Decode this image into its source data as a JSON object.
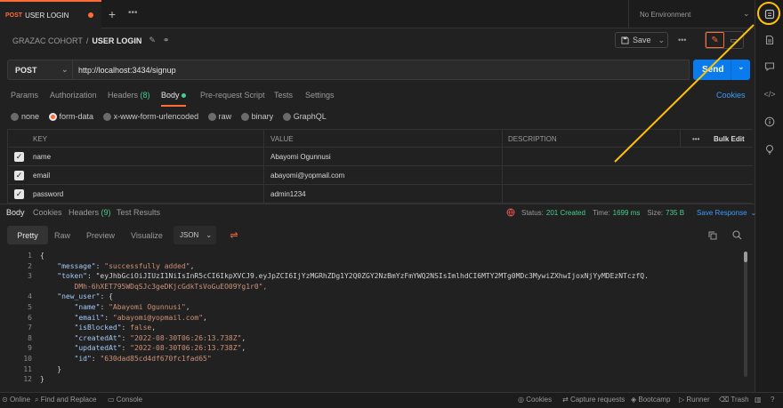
{
  "tab": {
    "method": "POST",
    "name": "USER LOGIN"
  },
  "environment": "No Environment",
  "breadcrumb": {
    "collection": "GRAZAC COHORT",
    "separator": "/",
    "request": "USER LOGIN"
  },
  "save_label": "Save",
  "request": {
    "method": "POST",
    "url": "http://localhost:3434/signup",
    "send_label": "Send"
  },
  "req_tabs": {
    "params": "Params",
    "authorization": "Authorization",
    "headers": "Headers",
    "headers_count": "(8)",
    "body": "Body",
    "prerequest": "Pre-request Script",
    "tests": "Tests",
    "settings": "Settings",
    "cookies": "Cookies"
  },
  "body_modes": {
    "none": "none",
    "form_data": "form-data",
    "urlencoded": "x-www-form-urlencoded",
    "raw": "raw",
    "binary": "binary",
    "graphql": "GraphQL"
  },
  "table": {
    "headers": {
      "key": "KEY",
      "value": "VALUE",
      "description": "DESCRIPTION",
      "bulk_edit": "Bulk Edit"
    },
    "rows": [
      {
        "key": "name",
        "value": "Abayomi Ogunnusi"
      },
      {
        "key": "email",
        "value": "abayomi@yopmail.com"
      },
      {
        "key": "password",
        "value": "admin1234"
      }
    ]
  },
  "resp_tabs": {
    "body": "Body",
    "cookies": "Cookies",
    "headers": "Headers",
    "headers_count": "(9)",
    "test_results": "Test Results"
  },
  "resp_status": {
    "status_label": "Status:",
    "status": "201 Created",
    "time_label": "Time:",
    "time": "1699 ms",
    "size_label": "Size:",
    "size": "735 B",
    "save_response": "Save Response"
  },
  "format": {
    "pretty": "Pretty",
    "raw": "Raw",
    "preview": "Preview",
    "visualize": "Visualize",
    "json": "JSON"
  },
  "code_lines": [
    "{",
    "    \"message\": \"successfully added\",",
    "    \"token\": \"eyJhbGciOiJIUzI1NiIsInR5cCI6IkpXVCJ9.eyJpZCI6IjYzMGRhZDg1Y2Q0ZGY2NzBmYzFmYWQ2NSIsImlhdCI6MTY2MTg0MDc3MywiZXhwIjoxNjYyMDEzNTczfQ.",
    "        DMh-6hXET795WDqSJc3geDKjcGdkTsVoGuEO09Yg1r0\",",
    "    \"new_user\": {",
    "        \"name\": \"Abayomi Ogunnusi\",",
    "        \"email\": \"abayomi@yopmail.com\",",
    "        \"isBlocked\": false,",
    "        \"createdAt\": \"2022-08-30T06:26:13.738Z\",",
    "        \"updatedAt\": \"2022-08-30T06:26:13.738Z\",",
    "        \"id\": \"630dad85cd4df670fc1fad65\"",
    "    }",
    "}"
  ],
  "line_numbers": [
    "1",
    "2",
    "3",
    "",
    "4",
    "5",
    "6",
    "7",
    "8",
    "9",
    "10",
    "11",
    "12"
  ],
  "footer": {
    "online": "Online",
    "find_replace": "Find and Replace",
    "console": "Console",
    "cookies": "Cookies",
    "capture": "Capture requests",
    "bootcamp": "Bootcamp",
    "runner": "Runner",
    "trash": "Trash"
  },
  "colors": {
    "accent": "#ff6c37",
    "send": "#097bed",
    "highlight": "#ffc107",
    "status_ok": "#49cc90"
  }
}
